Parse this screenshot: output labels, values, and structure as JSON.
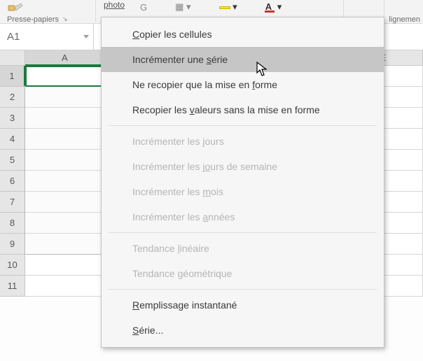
{
  "ribbon": {
    "clipboard_group_label": "Presse-papiers",
    "photo_label": "photo",
    "right_group_label": "lignemen"
  },
  "name_box": {
    "value": "A1"
  },
  "columns": [
    "A",
    "",
    "",
    "",
    "E"
  ],
  "active_column_index": 0,
  "rows": [
    "1",
    "2",
    "3",
    "4",
    "5",
    "6",
    "7",
    "8",
    "9",
    "10",
    "11"
  ],
  "active_row_index": 0,
  "context_menu": {
    "items": [
      {
        "label_parts": [
          [
            "C",
            "accel"
          ],
          [
            "opier les cellules",
            ""
          ]
        ],
        "enabled": true,
        "hovered": false
      },
      {
        "label_parts": [
          [
            "Incrémenter une ",
            ""
          ],
          [
            "s",
            "accel"
          ],
          [
            "érie",
            ""
          ]
        ],
        "enabled": true,
        "hovered": true
      },
      {
        "label_parts": [
          [
            "Ne recopier que la mise en ",
            ""
          ],
          [
            "f",
            "accel"
          ],
          [
            "orme",
            ""
          ]
        ],
        "enabled": true,
        "hovered": false
      },
      {
        "label_parts": [
          [
            "Recopier les ",
            ""
          ],
          [
            "v",
            "accel"
          ],
          [
            "aleurs sans la mise en forme",
            ""
          ]
        ],
        "enabled": true,
        "hovered": false
      },
      {
        "separator": true
      },
      {
        "label_parts": [
          [
            "Incrémenter les jours",
            ""
          ]
        ],
        "enabled": false
      },
      {
        "label_parts": [
          [
            "Incrémenter les j",
            ""
          ],
          [
            "o",
            "accel"
          ],
          [
            "urs de semaine",
            ""
          ]
        ],
        "enabled": false
      },
      {
        "label_parts": [
          [
            "Incrémenter les ",
            ""
          ],
          [
            "m",
            "accel"
          ],
          [
            "ois",
            ""
          ]
        ],
        "enabled": false
      },
      {
        "label_parts": [
          [
            "Incrémenter les ",
            ""
          ],
          [
            "a",
            "accel"
          ],
          [
            "nnées",
            ""
          ]
        ],
        "enabled": false
      },
      {
        "separator": true
      },
      {
        "label_parts": [
          [
            "Tendance ",
            ""
          ],
          [
            "l",
            "accel"
          ],
          [
            "inéaire",
            ""
          ]
        ],
        "enabled": false
      },
      {
        "label_parts": [
          [
            "Tendance ",
            ""
          ],
          [
            "g",
            "accel"
          ],
          [
            "éométrique",
            ""
          ]
        ],
        "enabled": false
      },
      {
        "separator": true
      },
      {
        "label_parts": [
          [
            "R",
            "accel"
          ],
          [
            "emplissage instantané",
            ""
          ]
        ],
        "enabled": true
      },
      {
        "label_parts": [
          [
            "S",
            "accel"
          ],
          [
            "érie...",
            ""
          ]
        ],
        "enabled": true
      }
    ]
  }
}
